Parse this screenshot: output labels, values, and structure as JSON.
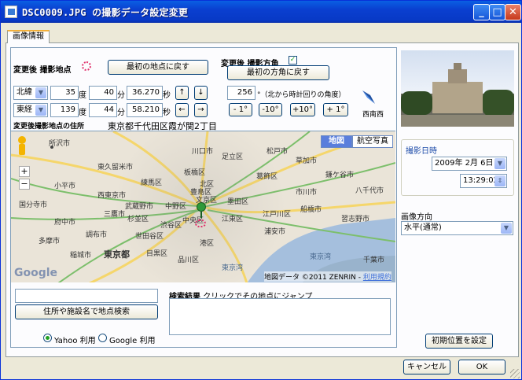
{
  "window": {
    "title": "DSC0009.JPG の撮影データ設定変更",
    "buttons": [
      "_",
      "□",
      "✕"
    ]
  },
  "tab": {
    "label": "画像情報"
  },
  "location": {
    "header": "変更後 撮影地点",
    "reset_button": "最初の地点に戻す",
    "lat_dir": "北緯",
    "lat_deg": "35",
    "lat_min": "40",
    "lat_sec": "36.270",
    "lon_dir": "東経",
    "lon_deg": "139",
    "lon_min": "44",
    "lon_sec": "58.210",
    "unit_deg": "度",
    "unit_min": "分",
    "unit_sec": "秒",
    "arrows": [
      "↑",
      "↓",
      "←",
      "→"
    ]
  },
  "direction": {
    "header": "変更後 撮影方角",
    "checked": true,
    "reset_button": "最初の方角に戻す",
    "value": "256",
    "note": "°（北から時計回りの角度）",
    "buttons": [
      "- 1°",
      "-10°",
      "+10°",
      "+ 1°"
    ],
    "compass_label": "西南西"
  },
  "address": {
    "label": "変更後撮影地点の住所",
    "value": "東京都千代田区霞が関2丁目"
  },
  "map": {
    "mode_tabs": [
      "地図",
      "航空写真"
    ],
    "active_mode": "地図",
    "copyright": "地図データ ©2011 ZENRIN",
    "terms_link": "利用規約",
    "logo": "Google",
    "zoom_in": "+",
    "zoom_out": "−",
    "places": [
      "所沢市",
      "東久留米市",
      "小平市",
      "国分寺市",
      "府中市",
      "多摩市",
      "稲城市",
      "調布市",
      "三鷹市",
      "武蔵野市",
      "西東京市",
      "練馬区",
      "板橋区",
      "北区",
      "足立区",
      "葛飾区",
      "江戸川区",
      "川口市",
      "草加市",
      "松戸市",
      "市川市",
      "鎌ケ谷市",
      "八千代市",
      "船橋市",
      "習志野市",
      "千葉市",
      "浦安市",
      "豊島区",
      "中野区",
      "杉並区",
      "世田谷区",
      "目黒区",
      "品川区",
      "渋谷区",
      "中央区",
      "江東区",
      "港区",
      "東京都",
      "墨田区",
      "文京区"
    ],
    "sea_labels": [
      "東京湾",
      "東京湾"
    ]
  },
  "search": {
    "input_value": "",
    "button": "住所や施設名で地点検索",
    "results_label": "検索結果",
    "results_hint": "クリックでその地点にジャンプ",
    "engine_yahoo": "Yahoo 利用",
    "engine_google": "Google 利用",
    "selected_engine": "Yahoo"
  },
  "datetime": {
    "label": "撮影日時",
    "date": "2009年 2月 6日",
    "time": "13:29:02"
  },
  "orientation": {
    "label": "画像方向",
    "value": "水平(通常)"
  },
  "footer": {
    "reset_button": "初期位置を設定",
    "cancel": "キャンセル",
    "ok": "OK"
  }
}
